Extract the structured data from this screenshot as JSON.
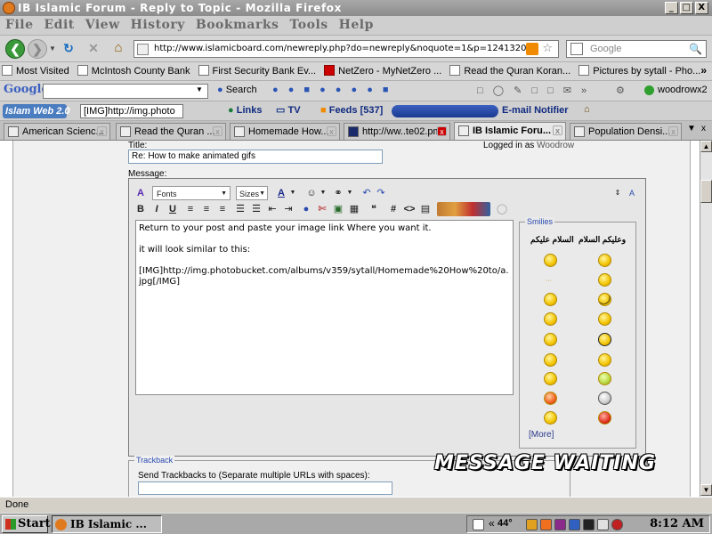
{
  "window": {
    "title": "IB Islamic Forum - Reply to Topic - Mozilla Firefox",
    "minimize": "_",
    "maximize": "□",
    "close": "X"
  },
  "menu": [
    "File",
    "Edit",
    "View",
    "History",
    "Bookmarks",
    "Tools",
    "Help"
  ],
  "nav": {
    "url": "http://www.islamicboard.com/newreply.php?do=newreply&noquote=1&p=1241320",
    "search_placeholder": "Google"
  },
  "bookmarks": [
    "Most Visited",
    "McIntosh County Bank",
    "First Security Bank Ev...",
    "NetZero - MyNetZero ...",
    "Read the Quran Koran...",
    "Pictures by sytall - Pho..."
  ],
  "google_bar": {
    "logo": "Google",
    "search_label": "Search",
    "account": "woodrowx2"
  },
  "islam_bar": {
    "logo": "Islam Web 2.0",
    "field_value": "[IMG]http://img.photo",
    "links": "Links",
    "tv": "TV",
    "feeds": "Feeds [537]",
    "email": "E-mail Notifier"
  },
  "tabs": [
    "American Scienc...",
    "Read the Quran ...",
    "Homemade How...",
    "http://ww..te02.pm",
    "IB Islamic Foru...",
    "Population Densi..."
  ],
  "form": {
    "title_label": "Title:",
    "title_value": "Re: How to make animated gifs",
    "logged_in_prefix": "Logged in as",
    "logged_in_user": "Woodrow",
    "message_label": "Message:",
    "fonts": "Fonts",
    "sizes": "Sizes",
    "message_lines": [
      "Return to your post and paste your image link Where you want it.",
      "it will look similar to this:",
      "[IMG]http://img.photobucket.com/albums/v359/sytall/Homemade%20How%20to/a.jpg[/IMG]"
    ],
    "smilies_legend": "Smilies",
    "smiley_header_left": "السلام عليكم",
    "smiley_header_right": "وعليكم السلام",
    "more_link": "More",
    "trackback_legend": "Trackback",
    "trackback_label": "Send Trackbacks to (Separate multiple URLs with spaces):"
  },
  "overlay": "MESSAGE WAITING",
  "status": "Done",
  "taskbar": {
    "start": "Start",
    "task": "IB Islamic ...",
    "temp": "44°",
    "clock": "8:12 AM"
  }
}
